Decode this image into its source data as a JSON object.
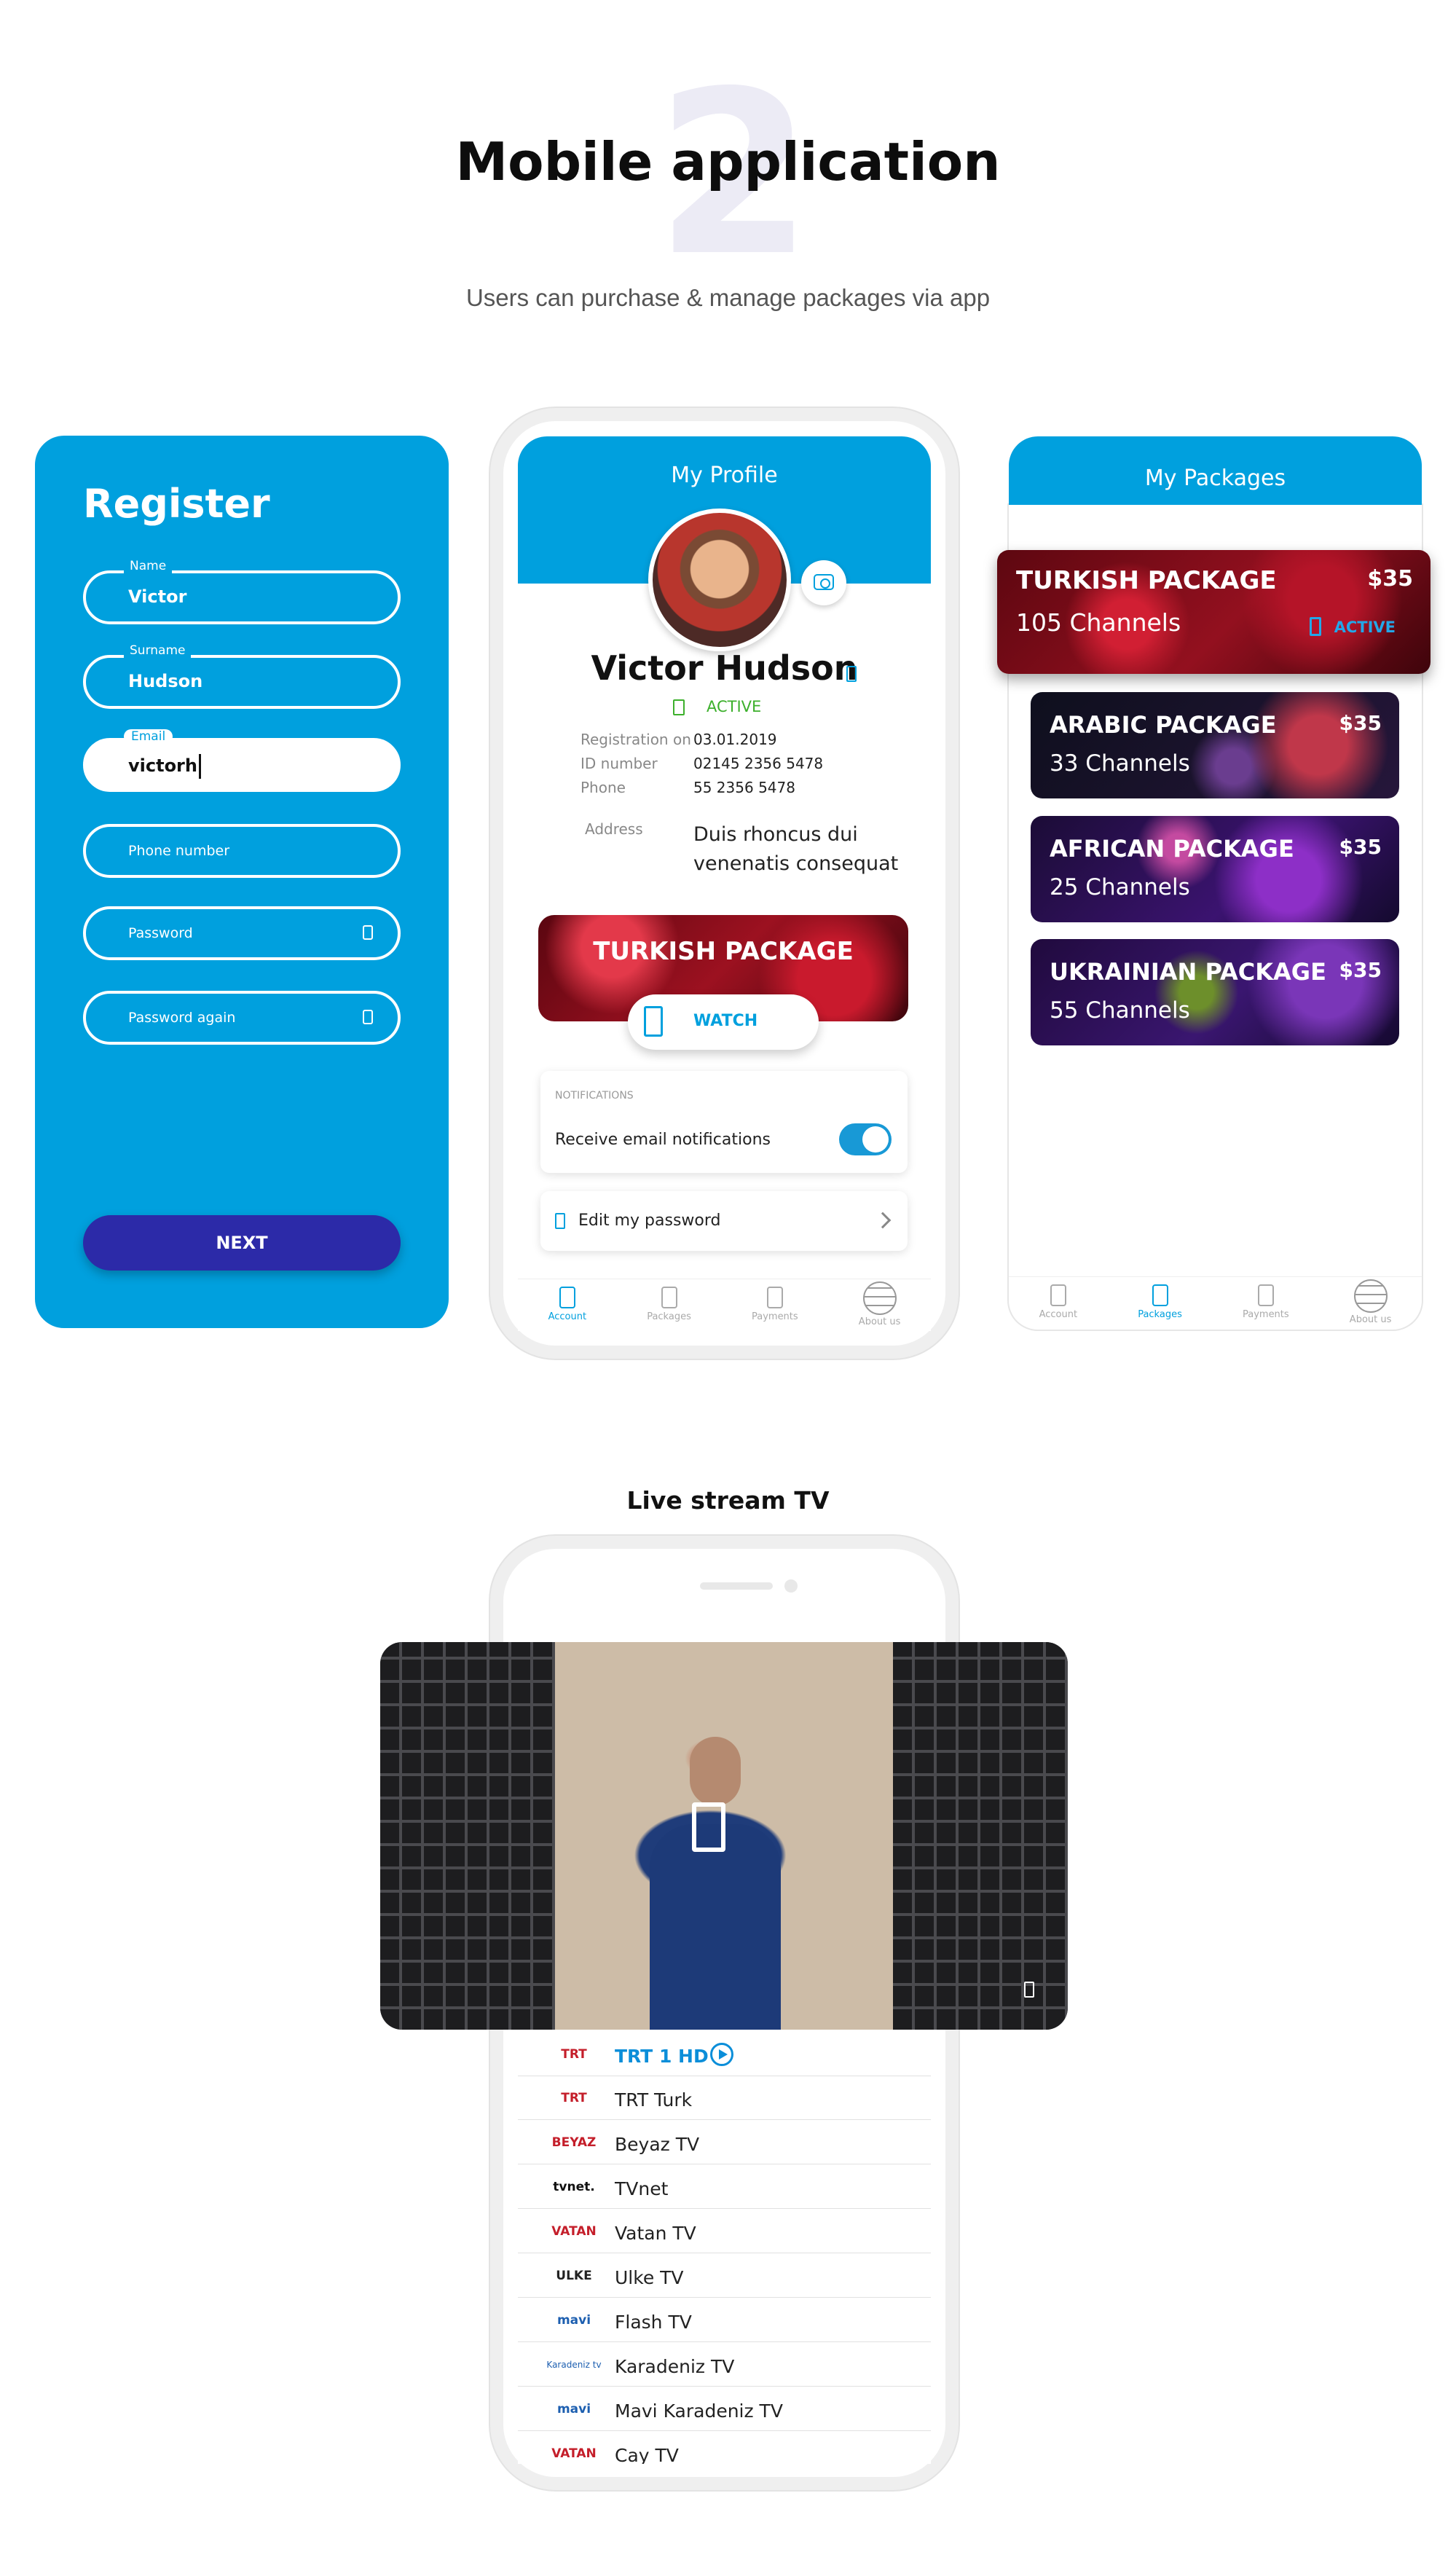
{
  "header": {
    "number": "2",
    "title": "Mobile application",
    "subtitle": "Users can purchase & manage packages via app"
  },
  "register": {
    "title": "Register",
    "fields": [
      {
        "label": "Name",
        "value": "Victor"
      },
      {
        "label": "Surname",
        "value": "Hudson"
      },
      {
        "label": "Email",
        "value": "victorh"
      },
      {
        "placeholder": "Phone number"
      },
      {
        "placeholder": "Password"
      },
      {
        "placeholder": "Password again"
      }
    ],
    "next_label": "NEXT"
  },
  "profile": {
    "title": "My Profile",
    "name": "Victor Hudson",
    "status": "ACTIVE",
    "info": [
      {
        "label": "Registration on",
        "value": "03.01.2019"
      },
      {
        "label": "ID number",
        "value": "02145 2356 5478"
      },
      {
        "label": "Phone",
        "value": "55 2356 5478"
      }
    ],
    "address_label": "Address",
    "address_value": "Duis rhoncus dui venenatis consequat",
    "package_banner": "TURKISH PACKAGE",
    "watch_label": "WATCH",
    "notifications_header": "NOTIFICATIONS",
    "notifications_toggle_label": "Receive email notifications",
    "notifications_enabled": true,
    "edit_password_label": "Edit my password",
    "nav": [
      "Account",
      "Packages",
      "Payments",
      "About us"
    ],
    "nav_active": "Account"
  },
  "packages": {
    "title": "My Packages",
    "items": [
      {
        "name": "TURKISH PACKAGE",
        "channels": "105 Channels",
        "price": "$35",
        "status": "ACTIVE"
      },
      {
        "name": "ARABIC PACKAGE",
        "channels": "33 Channels",
        "price": "$35"
      },
      {
        "name": "AFRICAN PACKAGE",
        "channels": "25 Channels",
        "price": "$35"
      },
      {
        "name": "UKRAINIAN PACKAGE",
        "channels": "55 Channels",
        "price": "$35"
      }
    ],
    "nav": [
      "Account",
      "Packages",
      "Payments",
      "About us"
    ],
    "nav_active": "Packages"
  },
  "live": {
    "title": "Live stream TV",
    "channels": [
      {
        "logo": "TRT",
        "name": "TRT 1 HD",
        "selected": true
      },
      {
        "logo": "TRT",
        "name": "TRT Turk"
      },
      {
        "logo": "BEYAZ",
        "name": "Beyaz TV"
      },
      {
        "logo": "tvnet.",
        "name": "TVnet"
      },
      {
        "logo": "VATAN",
        "name": "Vatan TV"
      },
      {
        "logo": "ULKE",
        "name": "Ulke TV"
      },
      {
        "logo": "mavi",
        "name": "Flash TV"
      },
      {
        "logo": "Karadeniz tv",
        "name": "Karadeniz TV"
      },
      {
        "logo": "mavi",
        "name": "Mavi Karadeniz TV"
      },
      {
        "logo": "VATAN",
        "name": "Cay TV"
      }
    ]
  },
  "colors": {
    "brand_blue": "#00a0de",
    "next_button": "#2c2aa8",
    "active_green": "#3db02c"
  },
  "icons": [
    "camera-icon",
    "edit-icon",
    "active-icon",
    "eye-icon",
    "play-icon",
    "fullscreen-icon",
    "chevron-right-icon",
    "globe-icon"
  ]
}
